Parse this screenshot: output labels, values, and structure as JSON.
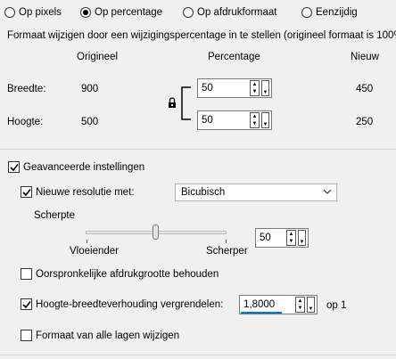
{
  "mode_options": [
    {
      "label": "Op pixels",
      "selected": false
    },
    {
      "label": "Op percentage",
      "selected": true
    },
    {
      "label": "Op afdrukformaat",
      "selected": false
    },
    {
      "label": "Eenzijdig",
      "selected": false
    }
  ],
  "description": "Formaat wijzigen door een wijzigingspercentage in te stellen (origineel formaat  is 100%).",
  "columns": {
    "original": "Origineel",
    "percentage": "Percentage",
    "new": "Nieuw"
  },
  "width_row": {
    "label": "Breedte:",
    "original": "900",
    "percentage": "50",
    "new": "450"
  },
  "height_row": {
    "label": "Hoogte:",
    "original": "500",
    "percentage": "50",
    "new": "250"
  },
  "advanced": {
    "label": "Geavanceerde instellingen",
    "checked": true,
    "resample": {
      "label": "Nieuwe resolutie met:",
      "checked": true,
      "method": "Bicubisch"
    },
    "sharpness": {
      "label": "Scherpte",
      "min_label": "Vloeiender",
      "max_label": "Scherper",
      "value": "50",
      "level": 0.5
    },
    "keep_print_size": {
      "label": "Oorspronkelijke afdrukgrootte behouden",
      "checked": false
    },
    "lock_aspect": {
      "label": "Hoogte-breedteverhouding vergrendelen:",
      "checked": true,
      "value": "1,8000",
      "suffix": "op 1"
    },
    "resize_all_layers": {
      "label": "Formaat van alle lagen wijzigen",
      "checked": false
    }
  },
  "colors": {
    "accent_underline": "#0078d7",
    "background": "#f0f0f0"
  }
}
